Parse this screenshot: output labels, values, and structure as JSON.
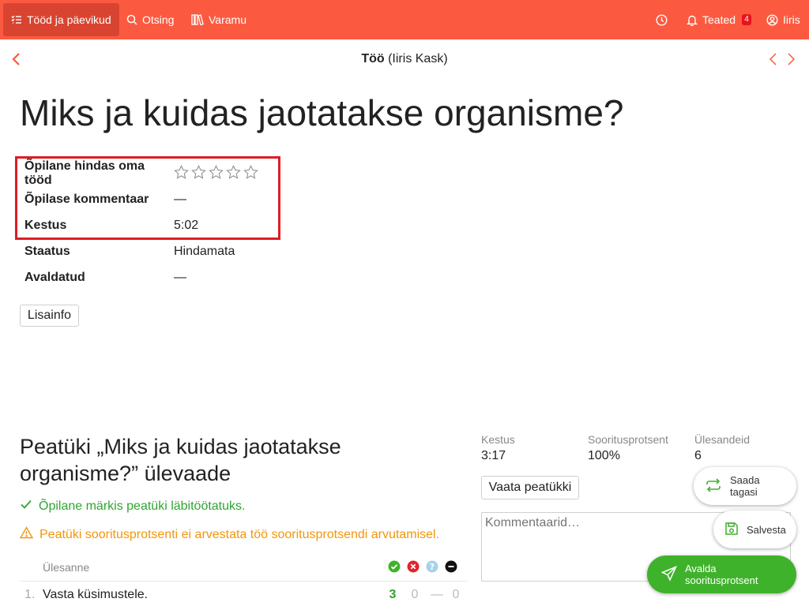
{
  "nav": {
    "works_label": "Tööd ja päevikud",
    "search_label": "Otsing",
    "library_label": "Varamu",
    "notifications_label": "Teated",
    "notifications_count": "4",
    "user_label": "Iiris"
  },
  "header": {
    "subtitle_bold": "Töö",
    "subtitle_rest": " (Iiris Kask)"
  },
  "page_title": "Miks ja kuidas jaotatakse organisme?",
  "info": {
    "rating_label": "Õpilane hindas oma tööd",
    "rating_stars": 0,
    "rating_max": 5,
    "comment_label": "Õpilase kommentaar",
    "comment_value": "—",
    "duration_label": "Kestus",
    "duration_value": "5:02",
    "status_label": "Staatus",
    "status_value": "Hindamata",
    "published_label": "Avaldatud",
    "published_value": "—"
  },
  "more_info_button": "Lisainfo",
  "chapter": {
    "title": "Peatüki „Miks ja kuidas jaotatakse organisme?” ülevaade",
    "ok_message": "Õpilane märkis peatüki läbitöötatuks.",
    "warn_message": "Peatüki sooritusprotsenti ei arvestata töö sooritusprotsendi arvutamisel.",
    "task_column": "Ülesanne",
    "tasks": [
      {
        "num": "1.",
        "name": "Vasta küsimustele.",
        "correct": "3",
        "wrong": "0",
        "unknown": "—",
        "skipped": "0"
      }
    ]
  },
  "stats": {
    "duration_label": "Kestus",
    "duration_value": "3:17",
    "percent_label": "Sooritusprotsent",
    "percent_value": "100%",
    "tasks_label": "Ülesandeid",
    "tasks_value": "6"
  },
  "view_chapter_button": "Vaata peatükki",
  "comment_placeholder": "Kommentaarid…",
  "actions": {
    "send_back": "Saada tagasi",
    "save": "Salvesta",
    "publish": "Avalda sooritusprotsent"
  },
  "colors": {
    "brand": "#fb5a41",
    "success": "#3fb22b",
    "warning": "#f2960a",
    "highlight": "#e01c24"
  }
}
